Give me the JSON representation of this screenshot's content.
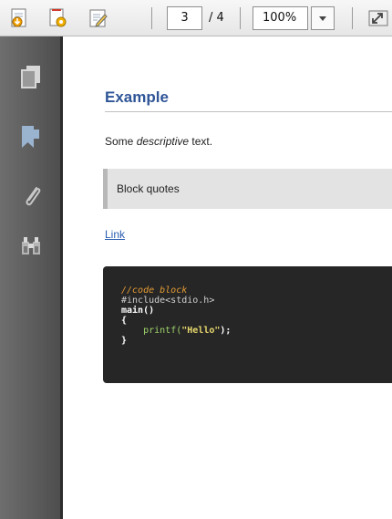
{
  "toolbar": {
    "current_page": "3",
    "page_total": "/ 4",
    "zoom": "100%",
    "icons": [
      "download-document-icon",
      "document-settings-icon",
      "edit-document-icon",
      "zoom-dropdown-icon",
      "fullscreen-icon"
    ]
  },
  "nav": {
    "icons": [
      "pages-icon",
      "bookmark-icon",
      "attachment-icon",
      "find-icon"
    ]
  },
  "document": {
    "heading": "Example",
    "para_before": "Some ",
    "para_em": "descriptive",
    "para_after": " text.",
    "quote": "Block quotes",
    "link": "Link",
    "code": {
      "comment": "//code block",
      "include": "#include<stdio.h>",
      "main": "main()",
      "open": "{",
      "indent": "    ",
      "printf": "printf(",
      "string": "\"Hello\"",
      "after": ");",
      "close": "}"
    }
  },
  "colors": {
    "heading": "#2f5597",
    "link": "#2a5db0",
    "code_bg": "#262626",
    "comment": "#e39a34",
    "string": "#e7d66b"
  }
}
